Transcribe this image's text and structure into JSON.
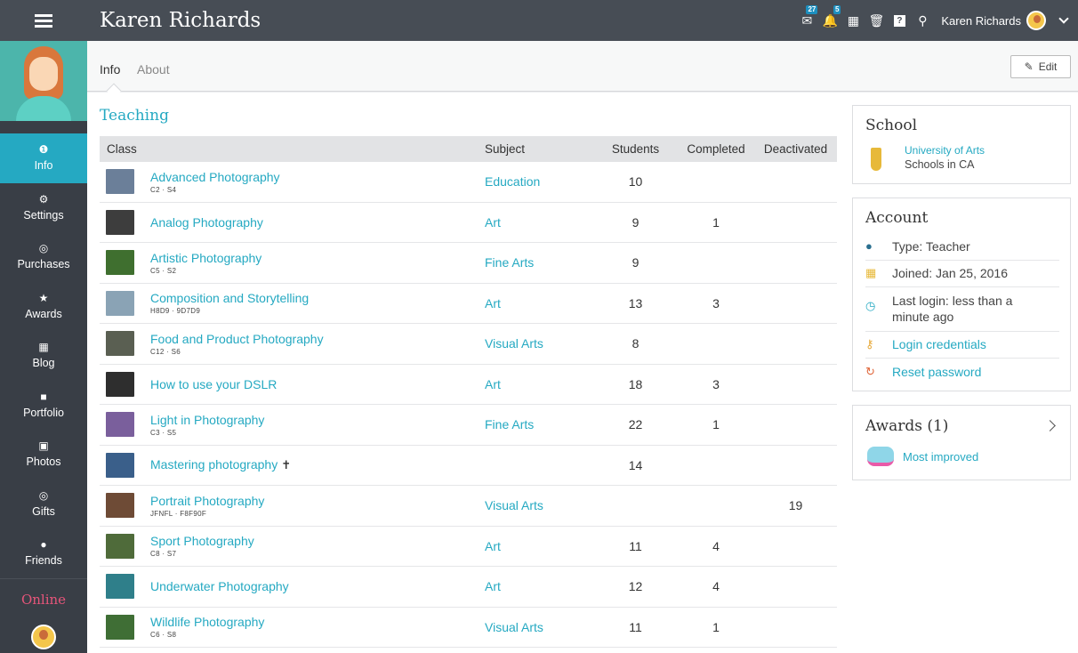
{
  "header": {
    "title": "Karen Richards",
    "user_name": "Karen Richards",
    "badges": {
      "messages": "27",
      "notifications": "5"
    }
  },
  "sidebar": {
    "items": [
      {
        "label": "Info",
        "icon": "info-icon"
      },
      {
        "label": "Settings",
        "icon": "gear-icon"
      },
      {
        "label": "Purchases",
        "icon": "coins-icon"
      },
      {
        "label": "Awards",
        "icon": "star-icon"
      },
      {
        "label": "Blog",
        "icon": "calendar-icon"
      },
      {
        "label": "Portfolio",
        "icon": "folder-icon"
      },
      {
        "label": "Photos",
        "icon": "image-icon"
      },
      {
        "label": "Gifts",
        "icon": "coins-icon"
      },
      {
        "label": "Friends",
        "icon": "users-icon"
      }
    ],
    "online_label": "Online"
  },
  "tabs": {
    "info": "Info",
    "about": "About",
    "edit_label": "Edit"
  },
  "teaching": {
    "title": "Teaching",
    "columns": [
      "Class",
      "Subject",
      "Students",
      "Completed",
      "Deactivated"
    ],
    "rows": [
      {
        "name": "Advanced Photography",
        "code": "C2 · S4",
        "subject": "Education",
        "students": "10",
        "completed": "",
        "deactivated": "",
        "thumb": "#6b7f99"
      },
      {
        "name": "Analog Photography",
        "code": "",
        "subject": "Art",
        "students": "9",
        "completed": "1",
        "deactivated": "",
        "thumb": "#3d3d3d"
      },
      {
        "name": "Artistic Photography",
        "code": "C5 · S2",
        "subject": "Fine Arts",
        "students": "9",
        "completed": "",
        "deactivated": "",
        "thumb": "#3f6f2f"
      },
      {
        "name": "Composition and Storytelling",
        "code": "H8D9 · 9D7D9",
        "subject": "Art",
        "students": "13",
        "completed": "3",
        "deactivated": "",
        "thumb": "#8aa3b5"
      },
      {
        "name": "Food and Product Photography",
        "code": "C12 · S6",
        "subject": "Visual Arts",
        "students": "8",
        "completed": "",
        "deactivated": "",
        "thumb": "#5a5f52"
      },
      {
        "name": "How to use your DSLR",
        "code": "",
        "subject": "Art",
        "students": "18",
        "completed": "3",
        "deactivated": "",
        "thumb": "#2e2e2e"
      },
      {
        "name": "Light in Photography",
        "code": "C3 · S5",
        "subject": "Fine Arts",
        "students": "22",
        "completed": "1",
        "deactivated": "",
        "thumb": "#7a5f9c"
      },
      {
        "name": "Mastering photography",
        "code": "",
        "subject": "",
        "students": "14",
        "completed": "",
        "deactivated": "",
        "thumb": "#3a5f8a",
        "pinned": true
      },
      {
        "name": "Portrait Photography",
        "code": "JFNFL · F8F90F",
        "subject": "Visual Arts",
        "students": "",
        "completed": "",
        "deactivated": "19",
        "thumb": "#6e4b36"
      },
      {
        "name": "Sport Photography",
        "code": "C8 · S7",
        "subject": "Art",
        "students": "11",
        "completed": "4",
        "deactivated": "",
        "thumb": "#4f6b3a"
      },
      {
        "name": "Underwater Photography",
        "code": "",
        "subject": "Art",
        "students": "12",
        "completed": "4",
        "deactivated": "",
        "thumb": "#2f7f8a"
      },
      {
        "name": "Wildlife Photography",
        "code": "C6 · S8",
        "subject": "Visual Arts",
        "students": "11",
        "completed": "1",
        "deactivated": "",
        "thumb": "#3f6e35"
      }
    ]
  },
  "school": {
    "title": "School",
    "name": "University of Arts",
    "location": "Schools in CA"
  },
  "account": {
    "title": "Account",
    "type": "Type: Teacher",
    "joined": "Joined: Jan 25, 2016",
    "last_login": "Last login: less than a minute ago",
    "login_credentials": "Login credentials",
    "reset_password": "Reset password"
  },
  "awards": {
    "title": "Awards (1)",
    "item": "Most improved"
  }
}
